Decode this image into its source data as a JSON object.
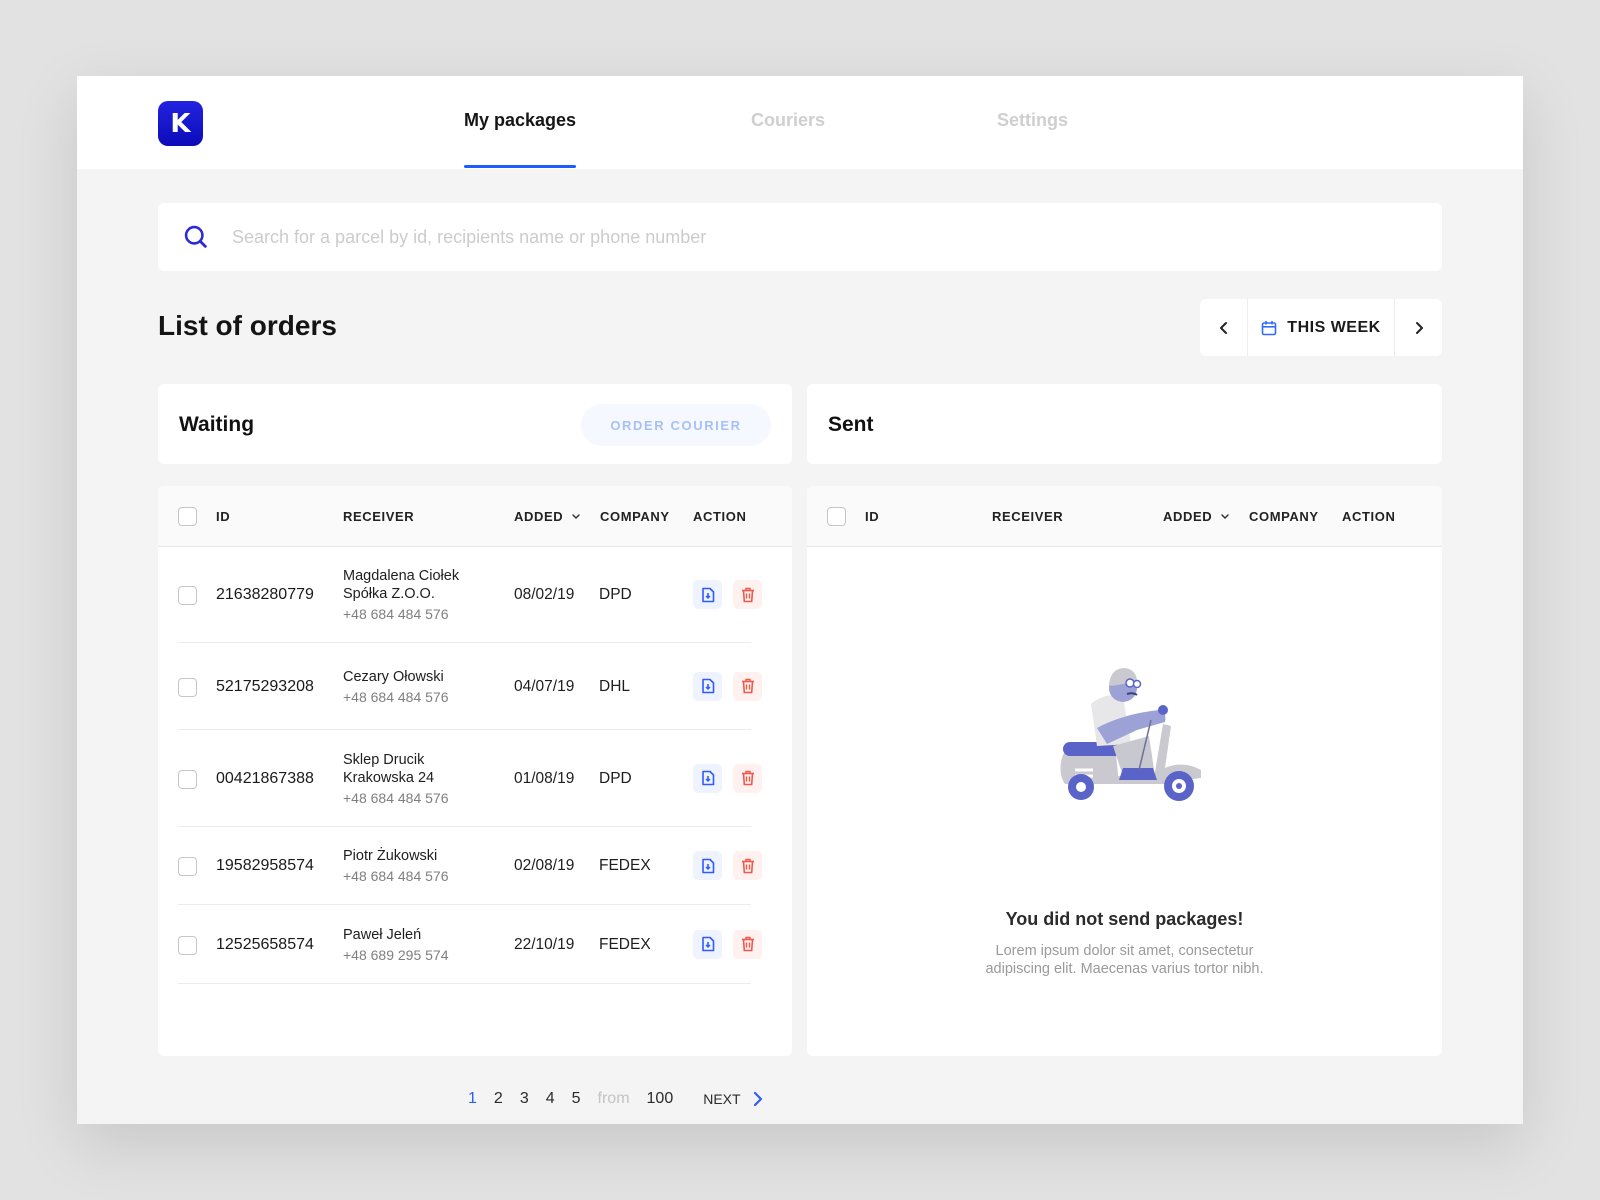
{
  "app": {
    "logo_letter": "K",
    "brand_color": "#1515d0",
    "accent_color": "#1f5cff"
  },
  "nav": {
    "tabs": [
      {
        "label": "My packages",
        "active": true
      },
      {
        "label": "Couriers",
        "active": false
      },
      {
        "label": "Settings",
        "active": false
      }
    ]
  },
  "search": {
    "placeholder": "Search for a parcel by id, recipients name or phone number",
    "value": "",
    "icon": "search-icon"
  },
  "orders": {
    "title": "List of orders",
    "period": {
      "label": "THIS WEEK",
      "prev_icon": "chevron-left-icon",
      "next_icon": "chevron-right-icon",
      "calendar_icon": "calendar-icon"
    }
  },
  "columns": [
    "ID",
    "RECEIVER",
    "ADDED",
    "COMPANY",
    "ACTION"
  ],
  "waiting": {
    "title": "Waiting",
    "order_courier_label": "ORDER COURIER",
    "rows": [
      {
        "id": "21638280779",
        "receiver_line1": "Magdalena Ciołek",
        "receiver_line2": "Spółka Z.O.O.",
        "phone": "+48 684 484 576",
        "added": "08/02/19",
        "company": "DPD"
      },
      {
        "id": "52175293208",
        "receiver_line1": "Cezary Ołowski",
        "receiver_line2": "",
        "phone": "+48 684 484 576",
        "added": "04/07/19",
        "company": "DHL"
      },
      {
        "id": "00421867388",
        "receiver_line1": "Sklep Drucik",
        "receiver_line2": "Krakowska 24",
        "phone": "+48 684 484 576",
        "added": "01/08/19",
        "company": "DPD"
      },
      {
        "id": "19582958574",
        "receiver_line1": "Piotr Żukowski",
        "receiver_line2": "",
        "phone": "+48 684 484 576",
        "added": "02/08/19",
        "company": "FEDEX"
      },
      {
        "id": "12525658574",
        "receiver_line1": "Paweł Jeleń",
        "receiver_line2": "",
        "phone": "+48 689 295 574",
        "added": "22/10/19",
        "company": "FEDEX"
      }
    ],
    "pagination": {
      "pages": [
        "1",
        "2",
        "3",
        "4",
        "5"
      ],
      "current": "1",
      "from_label": "from",
      "total": "100",
      "next_label": "NEXT"
    }
  },
  "sent": {
    "title": "Sent",
    "empty_title": "You did not send packages!",
    "empty_desc_line1": "Lorem ipsum dolor sit amet, consectetur",
    "empty_desc_line2": "adipiscing elit. Maecenas varius tortor nibh."
  }
}
